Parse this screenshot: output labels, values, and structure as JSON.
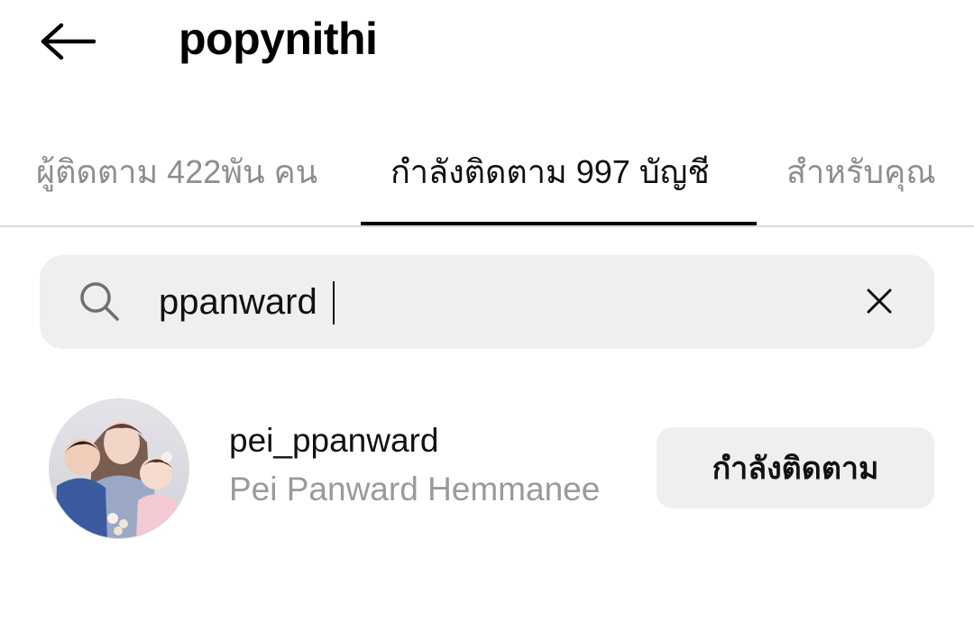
{
  "header": {
    "back_icon": "arrow-left-icon",
    "username": "popynithi"
  },
  "tabs": [
    {
      "label": "ผู้ติดตาม 422พัน คน",
      "active": false
    },
    {
      "label": "กำลังติดตาม 997 บัญชี",
      "active": true
    },
    {
      "label": "สำหรับคุณ",
      "active": false
    }
  ],
  "search": {
    "icon": "search-icon",
    "value": "ppanward",
    "clear_icon": "close-icon"
  },
  "results": [
    {
      "username": "pei_ppanward",
      "full_name": "Pei Panward Hemmanee",
      "button_label": "กำลังติดตาม"
    }
  ],
  "colors": {
    "inactive_text": "#8e8e8e",
    "secondary_text": "#9a9a9a",
    "search_bg": "#efefef",
    "button_bg": "#efefef",
    "divider": "#dbdbdb"
  }
}
